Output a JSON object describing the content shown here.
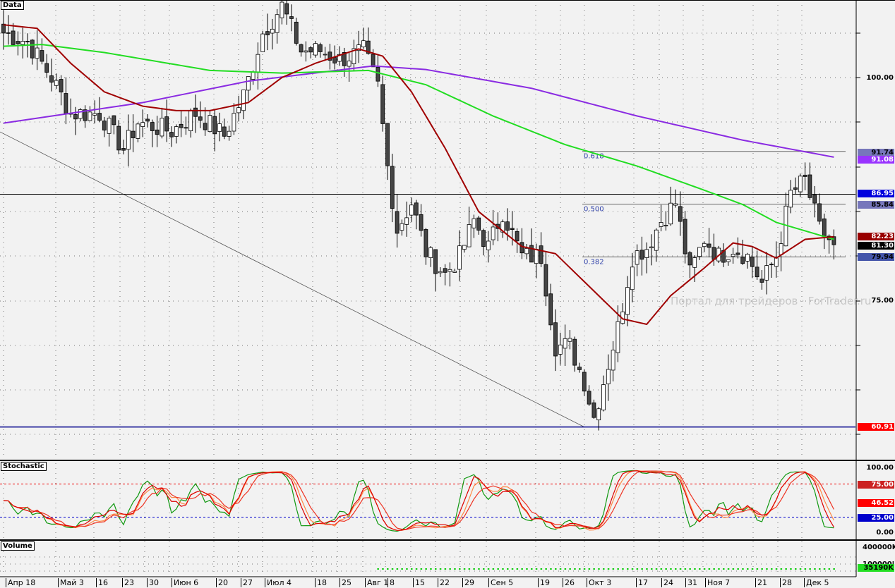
{
  "panels": {
    "main_title": "Data",
    "stochastic_title": "Stochastic",
    "volume_title": "Volume"
  },
  "watermark": "Портал для трейдеров · ForTrader.ru",
  "colors": {
    "ma_fast": "#a00000",
    "ma_mid": "#22dd22",
    "ma_slow": "#8a2be2",
    "bg": "#f2f2f2",
    "bull": "#ffffff",
    "bear": "#444444"
  },
  "chart_data": {
    "type": "candlestick",
    "x_tick_labels": [
      "Апр 18",
      "Май 3",
      "16",
      "23",
      "30",
      "Июн 6",
      "20",
      "27",
      "Июл 4",
      "18",
      "25",
      "Авг 1",
      "8",
      "15",
      "22",
      "29",
      "Сен 5",
      "19",
      "26",
      "Окт 3",
      "17",
      "24",
      "31",
      "Ноя 7",
      "21",
      "28",
      "Дек 5"
    ],
    "y_tick_labels": [
      "100.00",
      "75.00"
    ],
    "ylim": [
      52,
      114
    ],
    "close_keypoints": [
      [
        0,
        105
      ],
      [
        5,
        104
      ],
      [
        10,
        100
      ],
      [
        14,
        96
      ],
      [
        20,
        96
      ],
      [
        25,
        92
      ],
      [
        28,
        95
      ],
      [
        35,
        94
      ],
      [
        40,
        96
      ],
      [
        46,
        93.5
      ],
      [
        50,
        98
      ],
      [
        54,
        105
      ],
      [
        58,
        108
      ],
      [
        62,
        103
      ],
      [
        66,
        103
      ],
      [
        70,
        102
      ],
      [
        75,
        103
      ],
      [
        78,
        99
      ],
      [
        80,
        90
      ],
      [
        82,
        83
      ],
      [
        85,
        86
      ],
      [
        88,
        80.5
      ],
      [
        92,
        78
      ],
      [
        95,
        80
      ],
      [
        98,
        84
      ],
      [
        101,
        81
      ],
      [
        104,
        85
      ],
      [
        108,
        80
      ],
      [
        112,
        80
      ],
      [
        115,
        70
      ],
      [
        118,
        70
      ],
      [
        121,
        66
      ],
      [
        123,
        62
      ],
      [
        125,
        66
      ],
      [
        128,
        72
      ],
      [
        131,
        80
      ],
      [
        134,
        81
      ],
      [
        137,
        84
      ],
      [
        140,
        86
      ],
      [
        143,
        78
      ],
      [
        146,
        82
      ],
      [
        149,
        80
      ],
      [
        152,
        81
      ],
      [
        155,
        80
      ],
      [
        158,
        77
      ],
      [
        161,
        80
      ],
      [
        164,
        87
      ],
      [
        167,
        88.5
      ],
      [
        170,
        83
      ],
      [
        173,
        81.3
      ]
    ],
    "ma_fast": [
      [
        0,
        105.9
      ],
      [
        7,
        105.5
      ],
      [
        14,
        101.6
      ],
      [
        21,
        98.4
      ],
      [
        29,
        96.8
      ],
      [
        36,
        96.3
      ],
      [
        43,
        96.3
      ],
      [
        51,
        97.2
      ],
      [
        58,
        100
      ],
      [
        65,
        101.6
      ],
      [
        74,
        103.2
      ],
      [
        79,
        102.4
      ],
      [
        85,
        98.4
      ],
      [
        92,
        92.1
      ],
      [
        99,
        85
      ],
      [
        108,
        81.1
      ],
      [
        115,
        80.3
      ],
      [
        124,
        75.6
      ],
      [
        129,
        73
      ],
      [
        134,
        72.4
      ],
      [
        139,
        75.6
      ],
      [
        146,
        78.7
      ],
      [
        152,
        81.5
      ],
      [
        156,
        81.1
      ],
      [
        161,
        79.8
      ],
      [
        167,
        81.9
      ],
      [
        173,
        82.2
      ]
    ],
    "ma_mid": [
      [
        0,
        103.5
      ],
      [
        8,
        103.7
      ],
      [
        21,
        102.8
      ],
      [
        43,
        100.8
      ],
      [
        58,
        100.5
      ],
      [
        76,
        100.8
      ],
      [
        88,
        99.2
      ],
      [
        102,
        95.7
      ],
      [
        117,
        92.5
      ],
      [
        132,
        90.1
      ],
      [
        146,
        87.4
      ],
      [
        154,
        85.8
      ],
      [
        161,
        83.8
      ],
      [
        173,
        81.9
      ]
    ],
    "ma_slow": [
      [
        0,
        94.9
      ],
      [
        29,
        97.2
      ],
      [
        51,
        99.6
      ],
      [
        77,
        101.3
      ],
      [
        88,
        100.9
      ],
      [
        110,
        98.8
      ],
      [
        132,
        95.7
      ],
      [
        154,
        93
      ],
      [
        173,
        91.1
      ]
    ],
    "horizontal_lines": [
      {
        "value": 86.95,
        "label": "86.95",
        "color": "#0000dd"
      },
      {
        "value": 60.91,
        "label": "60.91",
        "color": "#ff0000"
      }
    ],
    "trendline": {
      "from": [
        0,
        94
      ],
      "to": [
        121,
        60.91
      ]
    },
    "fibonacci": [
      {
        "level": "0.618",
        "value": 91.74
      },
      {
        "level": "0.500",
        "value": 85.84
      },
      {
        "level": "0.382",
        "value": 79.94
      }
    ],
    "price_tags": [
      {
        "label": "91.74",
        "bg": "#7777bb"
      },
      {
        "label": "91.08",
        "bg": "#9933ff"
      },
      {
        "label": "86.95",
        "bg": "#0000dd"
      },
      {
        "label": "85.84",
        "bg": "#7777bb"
      },
      {
        "label": "82.23",
        "bg": "#990000"
      },
      {
        "label": "81.30",
        "bg": "#000000"
      },
      {
        "label": "79.94",
        "bg": "#4455aa"
      }
    ],
    "stochastic": {
      "axis_labels": [
        "100.00",
        "0.00"
      ],
      "levels": [
        75,
        25
      ],
      "tags": [
        {
          "label": "75.00",
          "bg": "#cc2222",
          "v": 75
        },
        {
          "label": "46.52",
          "bg": "#ff0000",
          "v": 46.52
        },
        {
          "label": "25.00",
          "bg": "#0000cc",
          "v": 25
        }
      ]
    },
    "volume": {
      "axis_labels": [
        "400000K",
        "100000K"
      ],
      "last": "35190K"
    }
  }
}
